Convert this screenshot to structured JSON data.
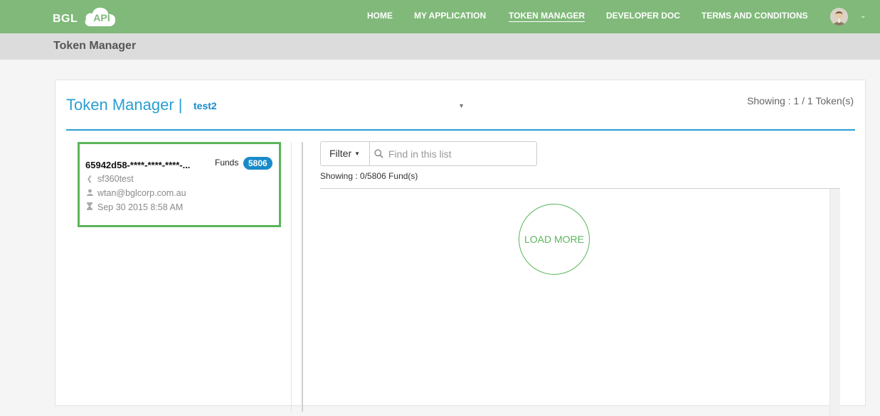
{
  "brand": {
    "name": "BGL",
    "badge": "API"
  },
  "nav": {
    "items": [
      {
        "label": "HOME"
      },
      {
        "label": "MY APPLICATION"
      },
      {
        "label": "TOKEN MANAGER",
        "active": true
      },
      {
        "label": "DEVELOPER DOC"
      },
      {
        "label": "TERMS AND CONDITIONS"
      }
    ],
    "user_menu_icon": "chevron-down-icon"
  },
  "subheader": {
    "title": "Token Manager"
  },
  "panel": {
    "title": "Token Manager |",
    "app_select": {
      "value": "test2"
    },
    "showing_tokens": "Showing : 1 / 1 Token(s)"
  },
  "token": {
    "id": "65942d58-****-****-****-",
    "funds_label": "Funds",
    "funds_count": "5806",
    "name": "sf360test",
    "email": "wtan@bglcorp.com.au",
    "created": "Sep 30 2015 8:58 AM"
  },
  "funds_list": {
    "filter_label": "Filter",
    "search_placeholder": "Find in this list",
    "showing": "Showing : 0/5806 Fund(s)",
    "load_more": "LOAD MORE"
  },
  "colors": {
    "nav_bg": "#80b97a",
    "accent_blue": "#2a9ed3",
    "badge_blue": "#1a8ac8",
    "active_green": "#5ab55a"
  }
}
